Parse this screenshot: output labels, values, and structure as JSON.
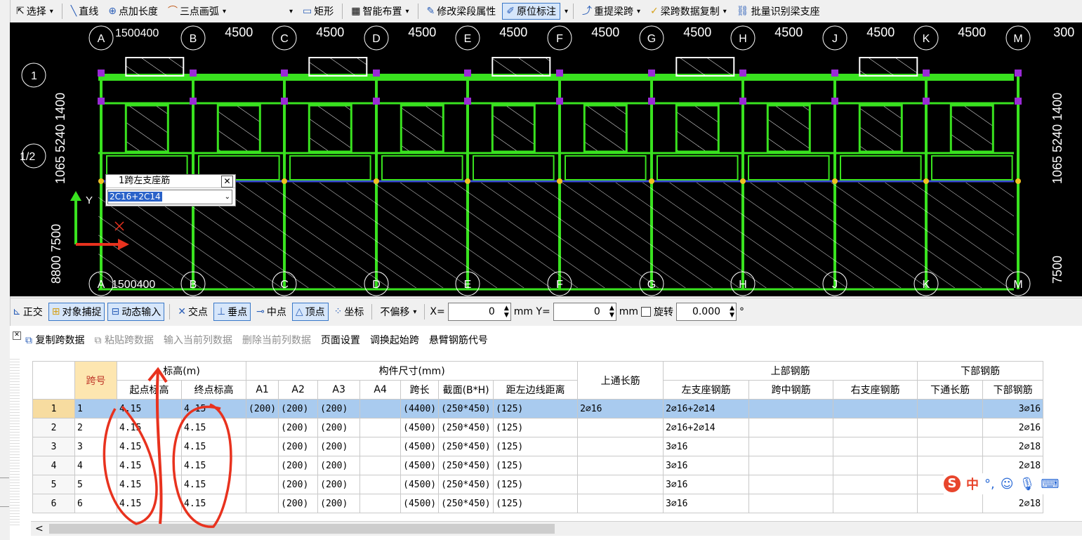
{
  "toolbar": {
    "items": [
      {
        "label": "选择",
        "icon": "cursor-icon",
        "caret": true
      },
      {
        "label": "直线",
        "icon": "line-icon"
      },
      {
        "label": "点加长度",
        "icon": "point-length-icon"
      },
      {
        "label": "三点画弧",
        "icon": "arc-icon",
        "caret": true
      },
      {
        "label": "",
        "icon": "",
        "caret": true
      },
      {
        "label": "矩形",
        "icon": "rectangle-icon"
      },
      {
        "label": "智能布置",
        "icon": "smart-layout-icon",
        "caret": true
      },
      {
        "label": "修改梁段属性",
        "icon": "edit-beam-icon"
      },
      {
        "label": "原位标注",
        "icon": "in-place-annotation-icon",
        "caret": true,
        "active": true
      },
      {
        "label": "重提梁跨",
        "icon": "re-extract-span-icon",
        "caret": true
      },
      {
        "label": "梁跨数据复制",
        "icon": "copy-span-icon",
        "caret": true
      },
      {
        "label": "批量识别梁支座",
        "icon": "batch-identify-icon"
      }
    ]
  },
  "canvas": {
    "top_axis": [
      {
        "letter": "A",
        "dim": "1500400"
      },
      {
        "letter": "B",
        "dim": "4500"
      },
      {
        "letter": "C",
        "dim": "4500"
      },
      {
        "letter": "D",
        "dim": "4500"
      },
      {
        "letter": "E",
        "dim": "4500"
      },
      {
        "letter": "F",
        "dim": "4500"
      },
      {
        "letter": "G",
        "dim": "4500"
      },
      {
        "letter": "H",
        "dim": "4500"
      },
      {
        "letter": "J",
        "dim": "4500"
      },
      {
        "letter": "K",
        "dim": "4500"
      },
      {
        "letter": "M",
        "dim": "300"
      }
    ],
    "bottom_axis_dim": "1500400",
    "row_labels": [
      "1",
      "1/2"
    ],
    "left_dims": [
      "1065 5240 1400",
      "8800 7500"
    ],
    "right_dims": [
      "1065 5240 1400",
      "7500"
    ],
    "popup": {
      "title": "1跨左支座筋",
      "value": "2C16+2C14"
    },
    "axis_y_label": "Y"
  },
  "snapbar": {
    "ortho": "正交",
    "object_snap": "对象捕捉",
    "dynamic_input": "动态输入",
    "intersection": "交点",
    "perpendicular": "垂点",
    "midpoint": "中点",
    "vertex": "顶点",
    "coordinate": "坐标",
    "offset_mode": "不偏移",
    "x_label": "X=",
    "x_value": "0",
    "y_label": "mm Y=",
    "y_value": "0",
    "unit_after_y": "mm",
    "rotate_label": "旋转",
    "rotate_value": "0.000",
    "degree": "°"
  },
  "data_toolbar": {
    "copy": "复制跨数据",
    "paste": "粘贴跨数据",
    "input_col": "输入当前列数据",
    "delete_col": "删除当前列数据",
    "page_setup": "页面设置",
    "swap_start": "调换起始跨",
    "cantilever": "悬臂钢筋代号"
  },
  "table": {
    "headers_top": {
      "span_no": "跨号",
      "elevation": "标高(m)",
      "dimensions": "构件尺寸(mm)",
      "top_long": "上通长筋",
      "top_rebar": "上部钢筋",
      "bottom_rebar": "下部钢筋"
    },
    "headers_sub": {
      "start_elev": "起点标高",
      "end_elev": "终点标高",
      "a1": "A1",
      "a2": "A2",
      "a3": "A3",
      "a4": "A4",
      "span_len": "跨长",
      "section": "截面(B*H)",
      "dist_left": "距左边线距离",
      "left_support": "左支座钢筋",
      "mid_span": "跨中钢筋",
      "right_support": "右支座钢筋",
      "bottom_long": "下通长筋",
      "bottom_part": "下部钢筋"
    },
    "rows": [
      {
        "rn": "1",
        "span": "1",
        "start": "4.15",
        "end": "4.15",
        "a1": "(200)",
        "a2": "(200)",
        "a3": "(200)",
        "a4": "",
        "len": "(4400)",
        "sec": "(250*450)",
        "dist": "(125)",
        "toplong": "2⌀16",
        "left": "2⌀16+2⌀14",
        "mid": "",
        "right": "",
        "botlong": "",
        "bot": "3⌀16",
        "selected": true
      },
      {
        "rn": "2",
        "span": "2",
        "start": "4.15",
        "end": "4.15",
        "a1": "",
        "a2": "(200)",
        "a3": "(200)",
        "a4": "",
        "len": "(4500)",
        "sec": "(250*450)",
        "dist": "(125)",
        "toplong": "",
        "left": "2⌀16+2⌀14",
        "mid": "",
        "right": "",
        "botlong": "",
        "bot": "2⌀16"
      },
      {
        "rn": "3",
        "span": "3",
        "start": "4.15",
        "end": "4.15",
        "a1": "",
        "a2": "(200)",
        "a3": "(200)",
        "a4": "",
        "len": "(4500)",
        "sec": "(250*450)",
        "dist": "(125)",
        "toplong": "",
        "left": "3⌀16",
        "mid": "",
        "right": "",
        "botlong": "",
        "bot": "2⌀18"
      },
      {
        "rn": "4",
        "span": "4",
        "start": "4.15",
        "end": "4.15",
        "a1": "",
        "a2": "(200)",
        "a3": "(200)",
        "a4": "",
        "len": "(4500)",
        "sec": "(250*450)",
        "dist": "(125)",
        "toplong": "",
        "left": "3⌀16",
        "mid": "",
        "right": "",
        "botlong": "",
        "bot": "2⌀18"
      },
      {
        "rn": "5",
        "span": "5",
        "start": "4.15",
        "end": "4.15",
        "a1": "",
        "a2": "(200)",
        "a3": "(200)",
        "a4": "",
        "len": "(4500)",
        "sec": "(250*450)",
        "dist": "(125)",
        "toplong": "",
        "left": "3⌀16",
        "mid": "",
        "right": "",
        "botlong": "",
        "bot": ""
      },
      {
        "rn": "6",
        "span": "6",
        "start": "4.15",
        "end": "4.15",
        "a1": "",
        "a2": "(200)",
        "a3": "(200)",
        "a4": "",
        "len": "(4500)",
        "sec": "(250*450)",
        "dist": "(125)",
        "toplong": "",
        "left": "3⌀16",
        "mid": "",
        "right": "",
        "botlong": "",
        "bot": "2⌀18"
      }
    ]
  },
  "ime": {
    "logo": "S",
    "mode": "中",
    "punct": "°,",
    "icons": [
      "emoji-icon",
      "microphone-icon",
      "keyboard-icon"
    ]
  },
  "colors": {
    "beam": "#39e21f",
    "axis": "#ffffff",
    "selected_row": "#a9cbef",
    "annotation": "#e8321e"
  }
}
